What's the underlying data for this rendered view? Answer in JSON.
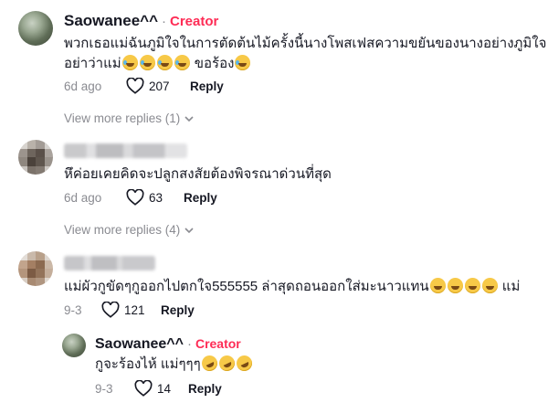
{
  "comments": [
    {
      "username": "Saowanee^^",
      "creator_label": "Creator",
      "text_line1": "พวกเธอแม่ฉันภูมิใจในการตัดต้นไม้ครั้งนี้นางโพสเฟสความขยันของนางอย่างภูมิใจ",
      "text_line2": "อย่าว่าแม่",
      "text_suffix": "ขอร้อง",
      "emoji": "tears-of-joy-emoji",
      "date": "6d ago",
      "likes": "207",
      "reply_label": "Reply",
      "view_more": "View more replies (1)"
    },
    {
      "text": "หึค่อยเคยคิดจะปลูกสงสัยต้องพิจรณาด่วนที่สุด",
      "date": "6d ago",
      "likes": "63",
      "reply_label": "Reply",
      "view_more": "View more replies (4)"
    },
    {
      "text": "แม่ผัวกูขัดๆกูออกไปตกใจ555555 ล่าสุดถอนออกใส่มะนาวแทน",
      "text_suffix": "แม่",
      "emoji": "squinting-laugh-emoji",
      "date": "9-3",
      "likes": "121",
      "reply_label": "Reply"
    }
  ],
  "reply": {
    "username": "Saowanee^^",
    "creator_label": "Creator",
    "text": "กูจะร้องไห้ แม่ๆๆๆ",
    "emoji": "rolling-laugh-emoji",
    "date": "9-3",
    "likes": "14",
    "reply_label": "Reply"
  }
}
